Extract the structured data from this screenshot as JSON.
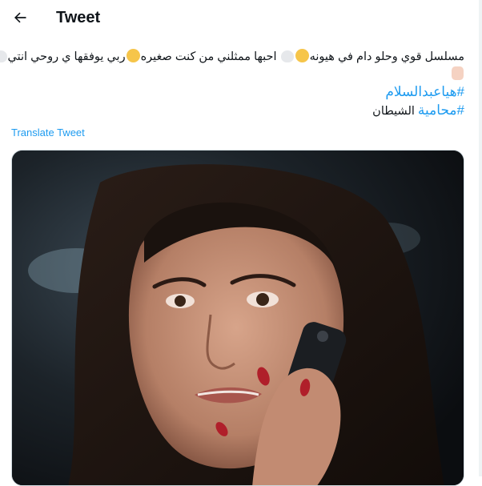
{
  "header": {
    "title": "Tweet"
  },
  "tweet": {
    "line1": "مسلسل قوي وحلو دام في هيونه",
    "line1b": "احبها ممثلني من كنت صغيره",
    "line1c": "ربي يوفقها ي روحي انتي",
    "hashtag1": "#هياعبدالسلام",
    "hashtag2": "#محامية",
    "line4_rest": " الشيطان",
    "translate": "Translate Tweet"
  },
  "icons": {
    "back": "back-arrow-icon",
    "heart": "white-heart-emoji",
    "face": "pleading-face-emoji",
    "hands": "folded-hands-emoji"
  },
  "colors": {
    "link": "#1d9bf0",
    "text": "#0f1419"
  }
}
